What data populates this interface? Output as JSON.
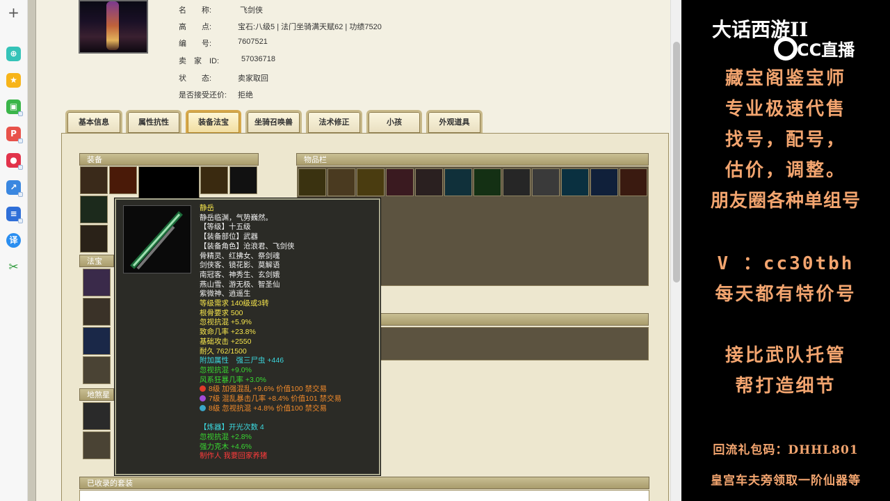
{
  "info": [
    {
      "key": "名　　称:",
      "value": "飞剑侠"
    },
    {
      "key": "高　　点:",
      "value": "宝石:八级5 | 法门坐骑满天赋62 | 功绩7520"
    },
    {
      "key": "编　　号:",
      "value": "7607521"
    },
    {
      "key": "卖　家　ID:",
      "value": "57036718"
    },
    {
      "key": "状　　态:",
      "value": "卖家取回"
    },
    {
      "key": "是否接受还价:",
      "value": "拒绝"
    }
  ],
  "tabs": [
    "基本信息",
    "属性抗性",
    "装备法宝",
    "坐骑召唤兽",
    "法术修正",
    "小孩",
    "外观道具"
  ],
  "active_tab": "装备法宝",
  "panels": {
    "equip": "装备",
    "inventory": "物品栏",
    "fabao": "法宝",
    "shengqi": "地煞星器",
    "sets": "已收录的套装"
  },
  "tooltip": {
    "lines": [
      {
        "text": "静岳",
        "color": "y"
      },
      {
        "text": "静岳临渊，气势巍然。",
        "color": "w"
      },
      {
        "text": "【等级】十五级",
        "color": "w"
      },
      {
        "text": "【装备部位】武器",
        "color": "w"
      },
      {
        "text": "【装备角色】沧浪君、飞剑侠",
        "color": "w"
      },
      {
        "text": "骨精灵、红拂女、祭剑魂",
        "color": "w"
      },
      {
        "text": "剑侠客、镜花影、莫解语",
        "color": "w"
      },
      {
        "text": "南冠客、神秀生、玄剑娥",
        "color": "w"
      },
      {
        "text": "燕山雪、游无极、智圣仙",
        "color": "w"
      },
      {
        "text": "紫微神、逍遥生",
        "color": "w"
      },
      {
        "text": "等级需求 140级或3转",
        "color": "y"
      },
      {
        "text": "根骨要求 500",
        "color": "y"
      },
      {
        "text": "忽视抗混 +5.9%",
        "color": "y"
      },
      {
        "text": "致命几率 +23.8%",
        "color": "y"
      },
      {
        "text": "基础攻击 +2550",
        "color": "y"
      },
      {
        "text": "耐久 762/1500",
        "color": "y"
      },
      {
        "text": "附加属性　强三尸虫 +446",
        "color": "c"
      },
      {
        "text": "忽视抗混 +9.0%",
        "color": "g"
      },
      {
        "text": "风系狂暴几率 +3.0%",
        "color": "g"
      },
      {
        "text": "8级 加强混乱 +9.6% 价值100 禁交易",
        "color": "o",
        "gem": "#e03a2a"
      },
      {
        "text": "7级 混乱暴击几率 +8.4% 价值101 禁交易",
        "color": "o",
        "gem": "#a24ad8"
      },
      {
        "text": "8级 忽视抗混 +4.8% 价值100 禁交易",
        "color": "o",
        "gem": "#3aa6c8"
      },
      {
        "text": "",
        "color": "w"
      },
      {
        "text": "【炼器】开光次数 4",
        "color": "c"
      },
      {
        "text": "忽视抗混 +2.8%",
        "color": "g"
      },
      {
        "text": "强力克木 +4.6%",
        "color": "g"
      },
      {
        "text": "制作人 我要回家养猪",
        "color": "r"
      }
    ]
  },
  "ad": {
    "logo_text": "大话西游II",
    "brand": "CC直播",
    "lines": [
      "藏宝阁鉴宝师",
      "专业极速代售",
      "找号，配号，",
      "估价，调整。",
      "朋友圈各种单组号",
      "V ：cc30tbh",
      "每天都有特价号",
      "接比武队托管",
      "帮打造细节",
      "回流礼包码：DHHL801",
      "皇宫车夫旁领取一阶仙器等"
    ]
  },
  "colors": {
    "ad_text": "#f3a56f",
    "tab_active": "#d7a94c"
  }
}
